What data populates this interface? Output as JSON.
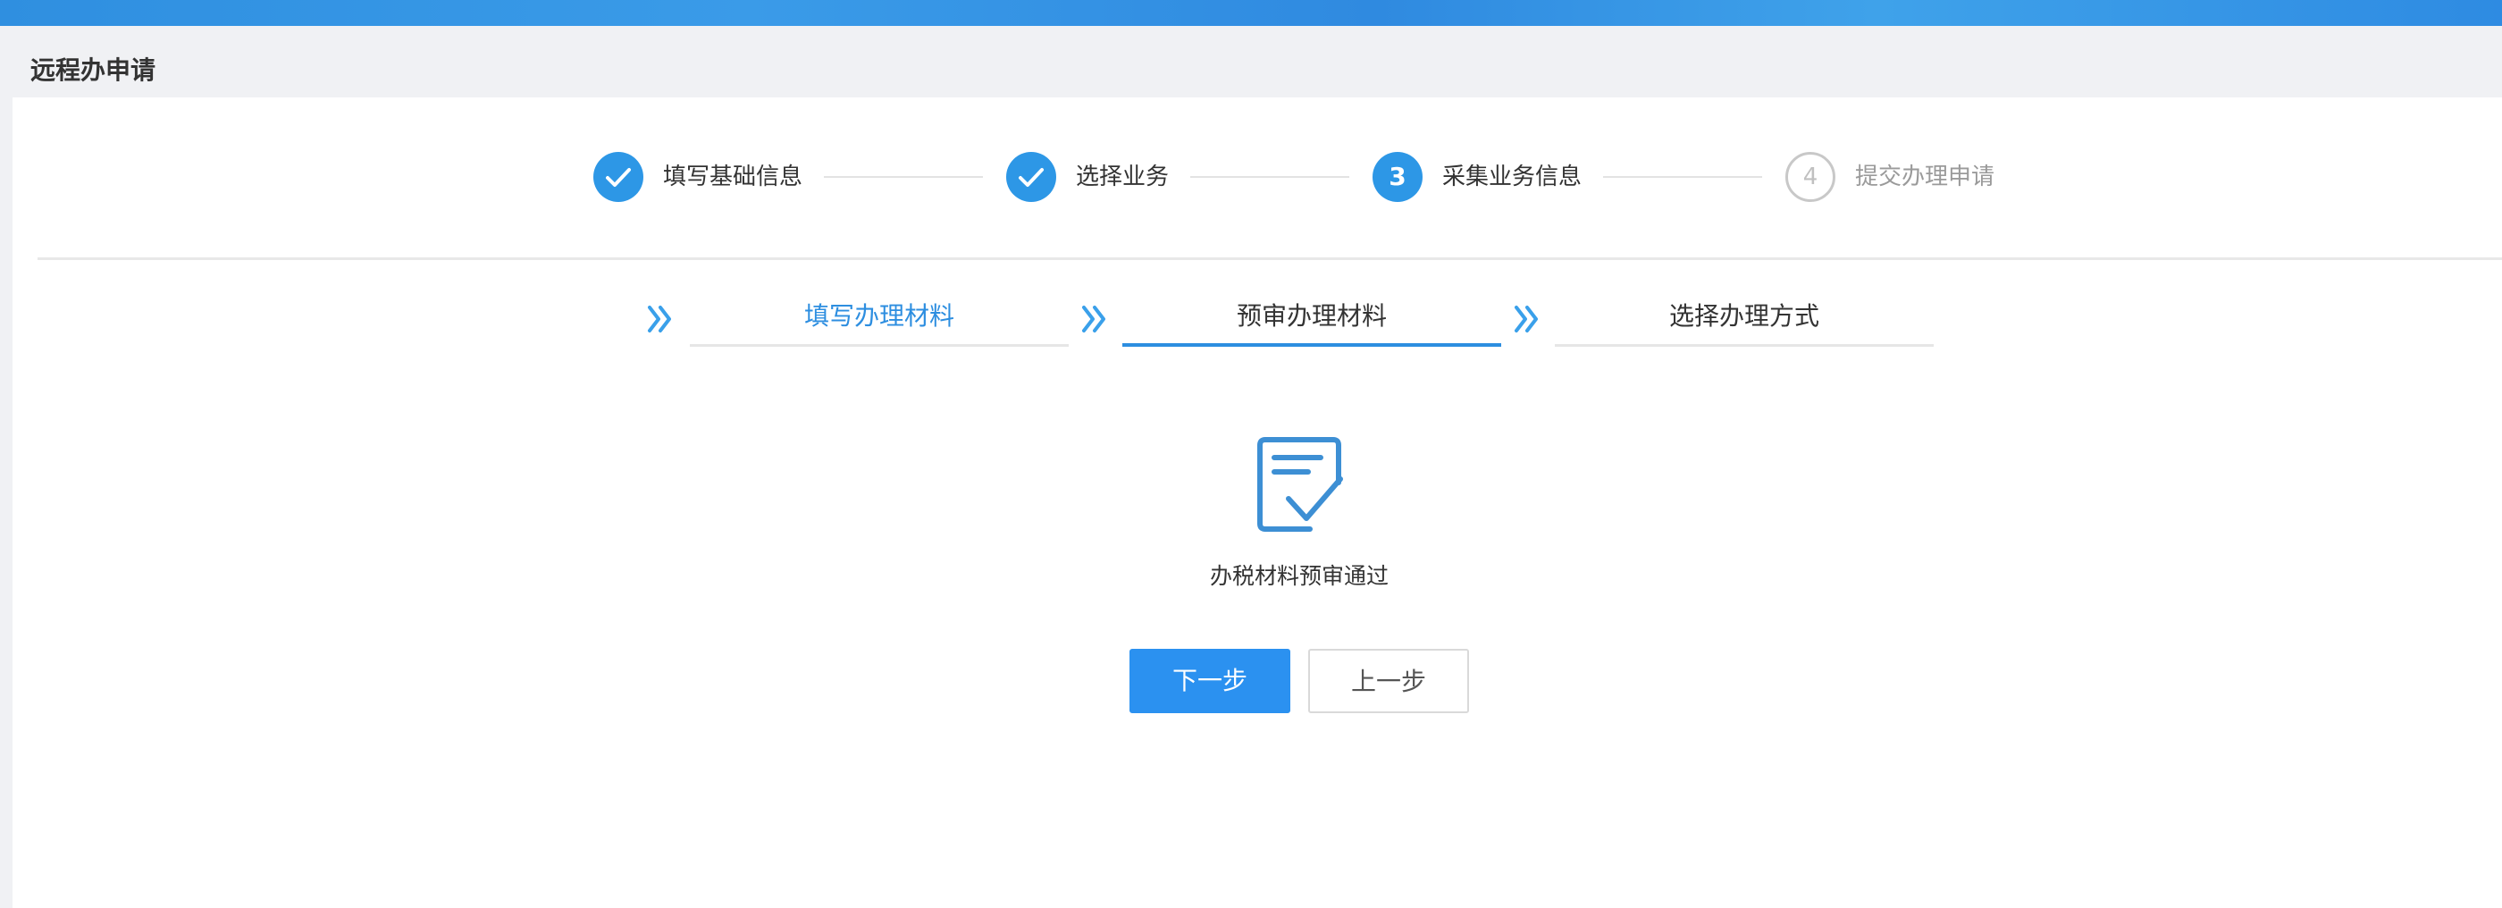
{
  "page": {
    "title": "远程办申请"
  },
  "steps": [
    {
      "label": "填写基础信息",
      "state": "done"
    },
    {
      "label": "选择业务",
      "state": "done"
    },
    {
      "label": "采集业务信息",
      "state": "active",
      "number": "3"
    },
    {
      "label": "提交办理申请",
      "state": "todo",
      "number": "4"
    }
  ],
  "subtabs": [
    {
      "label": "填写办理材料",
      "state": "done"
    },
    {
      "label": "预审办理材料",
      "state": "active"
    },
    {
      "label": "选择办理方式",
      "state": "todo"
    }
  ],
  "result": {
    "message": "办税材料预审通过",
    "icon": "document-check-icon"
  },
  "actions": {
    "next_label": "下一步",
    "prev_label": "上一步"
  },
  "colors": {
    "accent": "#2d8ee0",
    "step_done": "#2d97e6",
    "step_todo": "#c8c8c8",
    "button_primary": "#2b91f0"
  }
}
